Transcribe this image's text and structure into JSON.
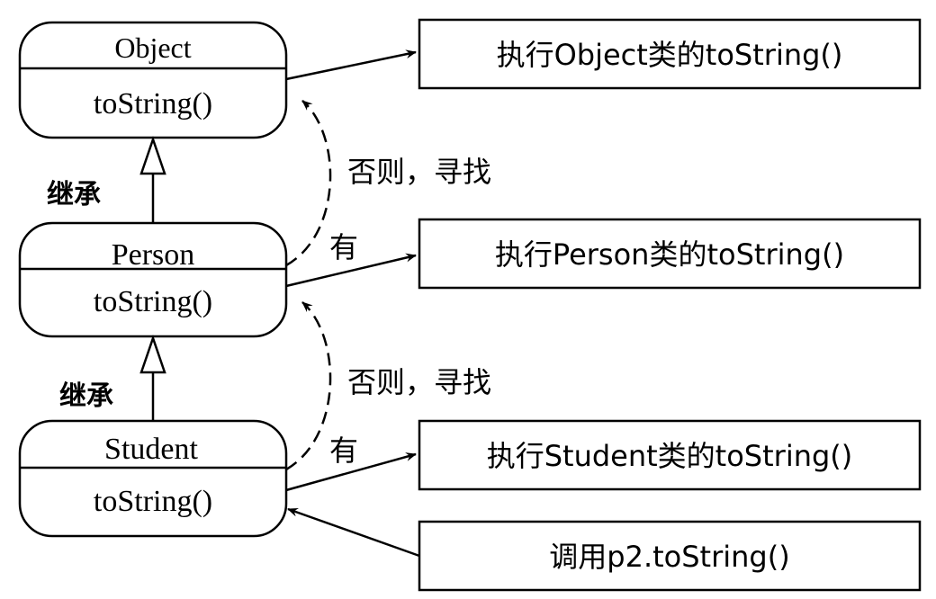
{
  "classes": {
    "object": {
      "name": "Object",
      "method": "toString()"
    },
    "person": {
      "name": "Person",
      "method": "toString()"
    },
    "student": {
      "name": "Student",
      "method": "toString()"
    }
  },
  "inheritance_labels": {
    "person_to_object": "继承",
    "student_to_person": "继承"
  },
  "lookup_labels": {
    "upper": "否则，寻找",
    "lower": "否则，寻找"
  },
  "has_labels": {
    "person": "有",
    "student": "有"
  },
  "result_boxes": {
    "object": "执行Object类的toString()",
    "person": "执行Person类的toString()",
    "student": "执行Student类的toString()",
    "call": "调用p2.toString()"
  },
  "colors": {
    "stroke": "#000000",
    "background": "#ffffff"
  }
}
